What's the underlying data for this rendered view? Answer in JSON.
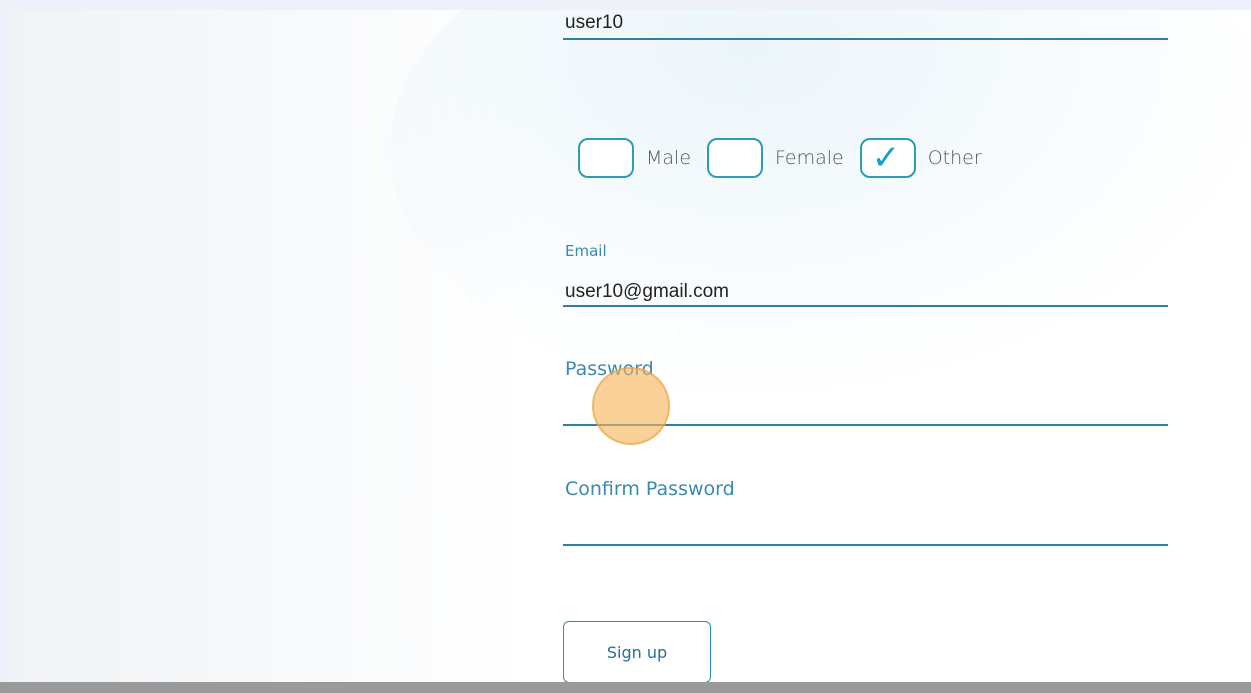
{
  "form": {
    "username": {
      "value": "user10"
    },
    "gender": {
      "options": [
        {
          "label": "Male",
          "checked": false
        },
        {
          "label": "Female",
          "checked": false
        },
        {
          "label": "Other",
          "checked": true
        }
      ],
      "check_glyph": "✓"
    },
    "email": {
      "label": "Email",
      "value": "user10@gmail.com"
    },
    "password": {
      "label": "Password",
      "value": ""
    },
    "confirm_password": {
      "label": "Confirm Password",
      "value": ""
    },
    "submit_label": "Sign up"
  },
  "colors": {
    "accent": "#2a9db8",
    "label": "#3a8ab0",
    "underline": "#2f7fa6",
    "cursor_highlight": "#f5b45a"
  }
}
